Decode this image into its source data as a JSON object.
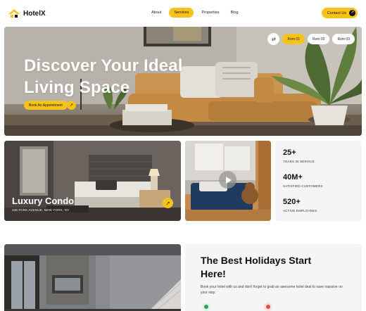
{
  "nav": {
    "logo_text": "HotelX",
    "links": [
      {
        "label": "About",
        "active": false
      },
      {
        "label": "Services",
        "active": true
      },
      {
        "label": "Properties",
        "active": false
      },
      {
        "label": "Blog",
        "active": false
      }
    ],
    "contact_label": "Contact Us"
  },
  "hero": {
    "title_line1": "Discover Your Ideal",
    "title_line2": "Living Space",
    "book_label": "Book An Appointment",
    "rooms": [
      {
        "label": "Rom 01",
        "active": true
      },
      {
        "label": "Rom 02",
        "active": false
      },
      {
        "label": "Rom 03",
        "active": false
      }
    ]
  },
  "condo": {
    "name": "Luxury Condo",
    "address": "345 PARK AVENUE, NEW YORK, NY"
  },
  "stats": [
    {
      "value": "25+",
      "label": "YEARS IN SERVICE"
    },
    {
      "value": "40M+",
      "label": "SATISFIED CUSTOMERS"
    },
    {
      "value": "520+",
      "label": "ACTIVE EMPLOYEES"
    }
  ],
  "holiday": {
    "title_line1": "The Best Holidays Start",
    "title_line2": "Here!",
    "description": "Book your hotel with us and don't forget to grab an awesome hotel deal to save massive on your stay."
  },
  "colors": {
    "accent": "#f7c21a",
    "dark": "#111111",
    "panel": "#f5f5f5"
  }
}
